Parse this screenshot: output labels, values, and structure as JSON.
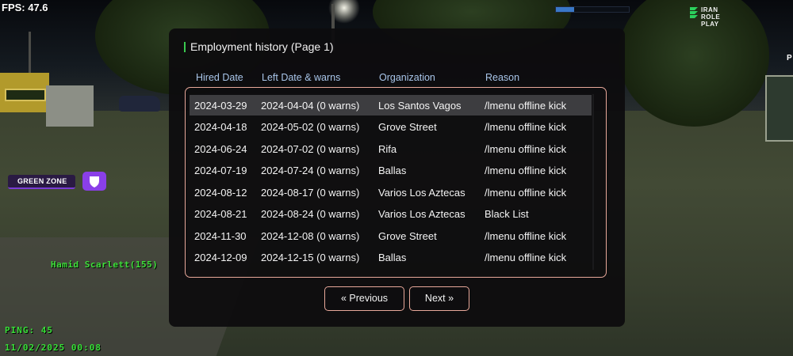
{
  "hud": {
    "fps": "FPS: 47.6",
    "logo_line1": "IRAN",
    "logo_line2": "ROLE PLAY",
    "green_zone": "GREEN ZONE",
    "player_tag": "Hamid Scarlett(155)",
    "ping": "PING: 45",
    "datetime": "11/02/2025 00:08",
    "right_edge_text": "P",
    "colors": {
      "hud_green": "#38e038",
      "zone_purple": "#8a3fe8",
      "accent_border": "#e8a89a",
      "header_blue": "#a9c6ea"
    }
  },
  "dialog": {
    "title": "Employment history (Page 1)",
    "columns": [
      "Hired Date",
      "Left Date & warns",
      "Organization",
      "Reason"
    ],
    "rows": [
      {
        "hired": "2024-03-29",
        "left": "2024-04-04 (0 warns)",
        "org": "Los Santos Vagos",
        "reason": "/lmenu offline kick",
        "selected": true
      },
      {
        "hired": "2024-04-18",
        "left": "2024-05-02 (0 warns)",
        "org": "Grove Street",
        "reason": "/lmenu offline kick"
      },
      {
        "hired": "2024-06-24",
        "left": "2024-07-02 (0 warns)",
        "org": "Rifa",
        "reason": "/lmenu offline kick"
      },
      {
        "hired": "2024-07-19",
        "left": "2024-07-24 (0 warns)",
        "org": "Ballas",
        "reason": "/lmenu offline kick"
      },
      {
        "hired": "2024-08-12",
        "left": "2024-08-17 (0 warns)",
        "org": "Varios Los Aztecas",
        "reason": "/lmenu offline kick"
      },
      {
        "hired": "2024-08-21",
        "left": "2024-08-24 (0 warns)",
        "org": "Varios Los Aztecas",
        "reason": "Black List"
      },
      {
        "hired": "2024-11-30",
        "left": "2024-12-08 (0 warns)",
        "org": "Grove Street",
        "reason": "/lmenu offline kick"
      },
      {
        "hired": "2024-12-09",
        "left": "2024-12-15 (0 warns)",
        "org": "Ballas",
        "reason": "/lmenu offline kick"
      }
    ],
    "prev_label": "« Previous",
    "next_label": "Next »"
  }
}
